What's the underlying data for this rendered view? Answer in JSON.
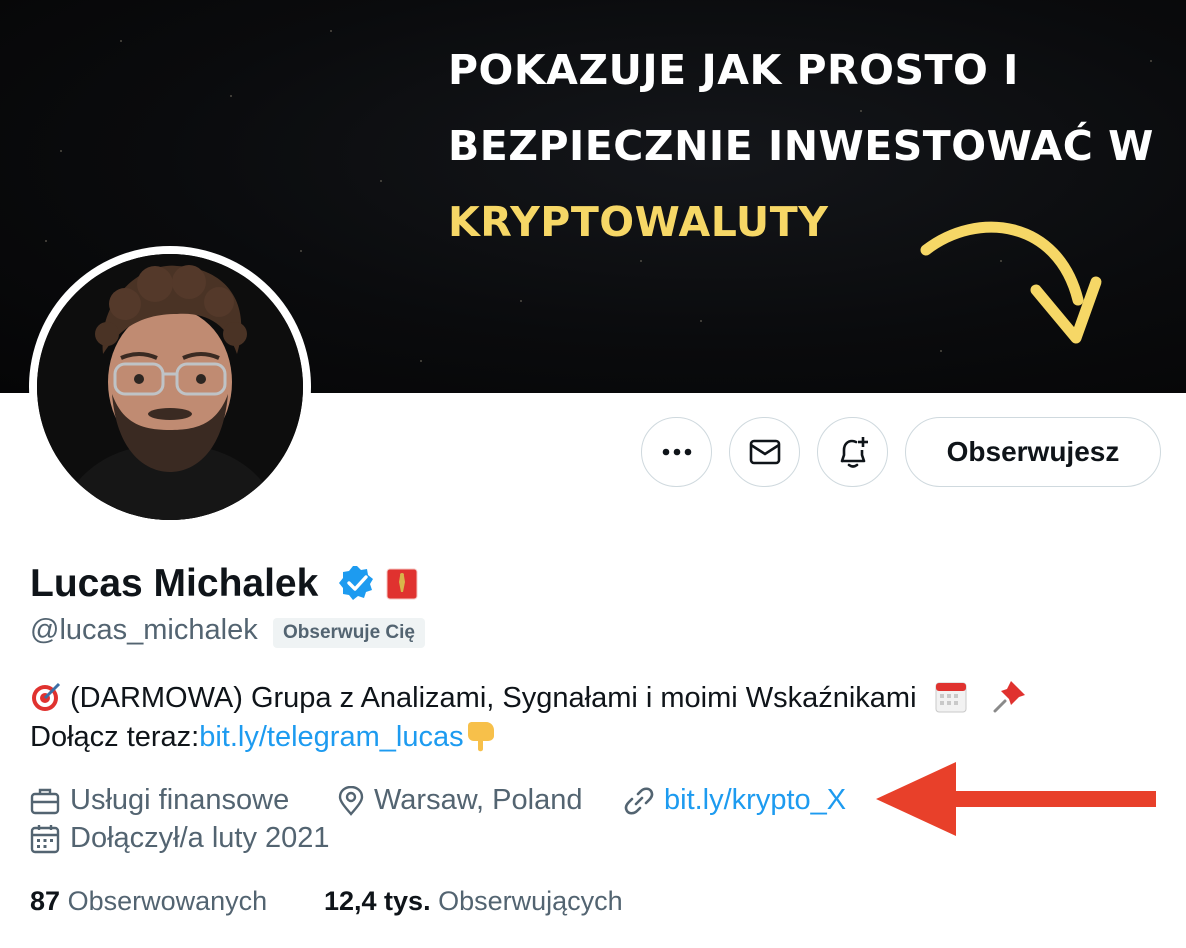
{
  "banner": {
    "line1": "POKAZUJE JAK PROSTO I",
    "line2": "BEZPIECZNIE INWESTOWAĆ W",
    "line3": "KRYPTOWALUTY",
    "accent_color": "#f6d766"
  },
  "actions": {
    "more_icon": "more-icon",
    "message_icon": "envelope-icon",
    "notify_icon": "bell-plus-icon",
    "follow_label": "Obserwujesz"
  },
  "profile": {
    "name": "Lucas Michalek",
    "handle": "@lucas_michalek",
    "follows_you": "Obserwuje Cię",
    "bio_line1": "(DARMOWA) Grupa z Analizami, Sygnałami i moimi Wskaźnikami",
    "bio_line2_prefix": "Dołącz teraz:",
    "bio_link": "bit.ly/telegram_lucas",
    "category": "Usługi finansowe",
    "location": "Warsaw, Poland",
    "website": "bit.ly/krypto_X",
    "joined": "Dołączył/a luty 2021"
  },
  "stats": {
    "following_count": "87",
    "following_label": "Obserwowanych",
    "followers_count": "12,4 tys.",
    "followers_label": "Obserwujących"
  },
  "colors": {
    "link": "#1d9bf0",
    "verified": "#1d9bf0",
    "annotation_arrow": "#e8402a"
  }
}
